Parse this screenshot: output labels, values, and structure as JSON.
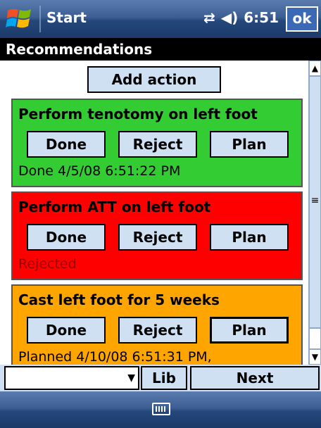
{
  "taskbar": {
    "app_name": "Start",
    "time": "6:51",
    "ok_label": "ok",
    "icons": [
      "windows-logo-icon",
      "connectivity-icon",
      "volume-icon"
    ]
  },
  "title": "Recommendations",
  "add_action_label": "Add action",
  "cards": [
    {
      "title": "Perform tenotomy on left foot",
      "done_label": "Done",
      "reject_label": "Reject",
      "plan_label": "Plan",
      "status": "Done 4/5/08 6:51:22 PM",
      "color": "#33cc33"
    },
    {
      "title": "Perform ATT on left foot",
      "done_label": "Done",
      "reject_label": "Reject",
      "plan_label": "Plan",
      "status": "Rejected",
      "color": "#ff0000"
    },
    {
      "title": "Cast left foot for 5 weeks",
      "done_label": "Done",
      "reject_label": "Reject",
      "plan_label": "Plan",
      "status": "Planned 4/10/08 6:51:31 PM,",
      "color": "#ffa500"
    }
  ],
  "bottom": {
    "combo_value": "",
    "lib_label": "Lib",
    "next_label": "Next"
  },
  "softkey": {
    "icon": "keyboard-icon"
  }
}
